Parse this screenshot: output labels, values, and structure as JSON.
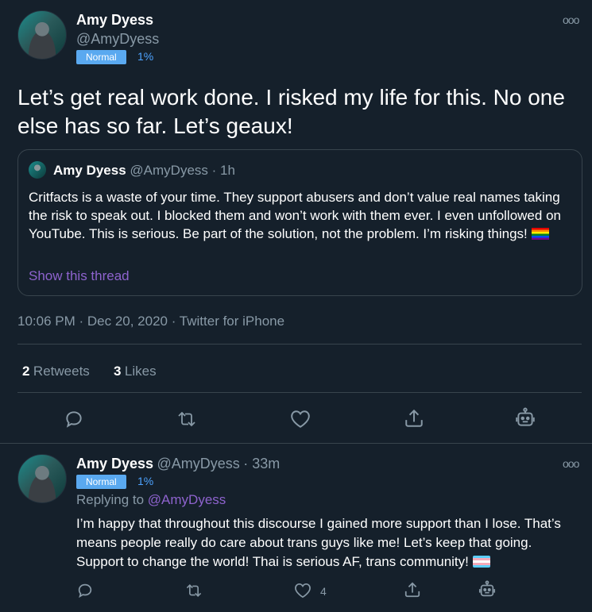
{
  "tweet": {
    "name": "Amy Dyess",
    "handle": "@AmyDyess",
    "badge": "Normal",
    "percent": "1%",
    "text": "Let’s get real work done. I risked my life for this. No one else has so far. Let’s geaux!",
    "timestamp": "10:06 PM · Dec 20, 2020 · Twitter for iPhone",
    "retweets_count": "2",
    "retweets_label": "Retweets",
    "likes_count": "3",
    "likes_label": "Likes"
  },
  "quoted": {
    "name": "Amy Dyess",
    "handle": "@AmyDyess",
    "time": "· 1h",
    "text": "Critfacts is a waste of your time. They support abusers and don’t value real names taking the risk to speak out. I blocked  them and won’t work with them ever. I even unfollowed on YouTube. This is serious. Be part of the solution, not the problem. I’m risking things!",
    "show_thread": "Show this thread"
  },
  "reply": {
    "name": "Amy Dyess",
    "handle": "@AmyDyess",
    "time": "· 33m",
    "badge": "Normal",
    "percent": "1%",
    "replying_to_label": "Replying to",
    "replying_to_handle": "@AmyDyess",
    "text": "I’m happy that throughout this discourse I gained more support than I lose. That’s means people really do care about trans guys like me! Let’s keep that going. Support to change the world! Thai is serious AF, trans community!",
    "like_count": "4"
  },
  "more_glyph": "ooo",
  "icons": [
    "reply-icon",
    "retweet-icon",
    "like-icon",
    "share-icon",
    "bot-icon",
    "more-icon"
  ]
}
